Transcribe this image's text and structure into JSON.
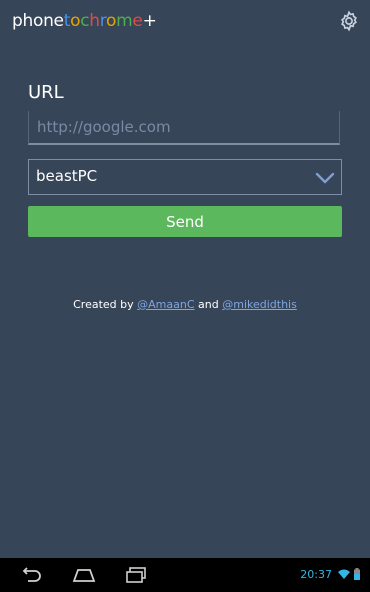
{
  "app": {
    "logo_parts": [
      {
        "text": "phone",
        "color": "#ffffff"
      },
      {
        "text": "t",
        "color": "#4a90e2"
      },
      {
        "text": "o",
        "color": "#e5a400"
      },
      {
        "text": "c",
        "color": "#4cae4c"
      },
      {
        "text": "h",
        "color": "#e24a4a"
      },
      {
        "text": "r",
        "color": "#4a90e2"
      },
      {
        "text": "o",
        "color": "#e5a400"
      },
      {
        "text": "m",
        "color": "#4cae4c"
      },
      {
        "text": "e",
        "color": "#e24a4a"
      },
      {
        "text": "+",
        "color": "#ffffff"
      }
    ],
    "settings_icon": "gear-icon"
  },
  "form": {
    "url_label": "URL",
    "url_placeholder": "http://google.com",
    "url_value": "",
    "device_selected": "beastPC",
    "send_label": "Send"
  },
  "credits": {
    "prefix": "Created by",
    "author1": "@AmaanC",
    "joiner": "and",
    "author2": "@mikedidthis"
  },
  "system_bar": {
    "time": "20:37",
    "back_icon": "back-icon",
    "home_icon": "home-icon",
    "recents_icon": "recents-icon"
  },
  "colors": {
    "background": "#374559",
    "send_button": "#5cb85c",
    "link": "#7ea6e0",
    "clock": "#33b5e5"
  }
}
